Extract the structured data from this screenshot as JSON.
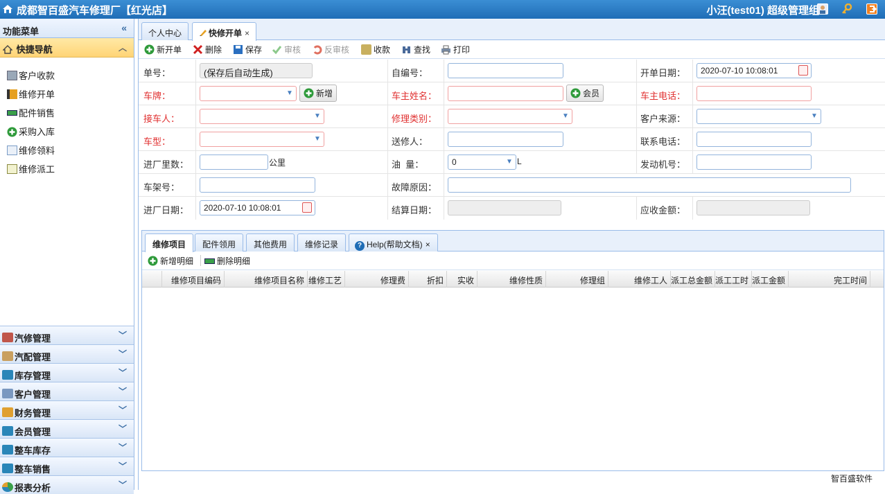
{
  "header": {
    "title": "成都智百盛汽车修理厂【红光店】",
    "user": "小汪(test01)  超级管理组"
  },
  "sidebar": {
    "menu_title": "功能菜单",
    "quick_nav": "快捷导航",
    "quick_items": [
      {
        "label": "客户收款",
        "icon": "cash-register-icon"
      },
      {
        "label": "维修开单",
        "icon": "notebook-icon"
      },
      {
        "label": "配件销售",
        "icon": "card-icon"
      },
      {
        "label": "采购入库",
        "icon": "plus-icon"
      },
      {
        "label": "维修领料",
        "icon": "form-icon"
      },
      {
        "label": "维修派工",
        "icon": "checklist-icon"
      }
    ],
    "groups": [
      {
        "label": "汽修管理",
        "icon": "tools-icon"
      },
      {
        "label": "汽配管理",
        "icon": "box-icon"
      },
      {
        "label": "库存管理",
        "icon": "warehouse-icon"
      },
      {
        "label": "客户管理",
        "icon": "contact-icon"
      },
      {
        "label": "财务管理",
        "icon": "finance-icon"
      },
      {
        "label": "会员管理",
        "icon": "member-icon"
      },
      {
        "label": "整车库存",
        "icon": "vehicle-stock-icon"
      },
      {
        "label": "整车销售",
        "icon": "vehicle-sales-icon"
      },
      {
        "label": "报表分析",
        "icon": "pie-chart-icon"
      }
    ]
  },
  "tabs": [
    {
      "label": "个人中心"
    },
    {
      "label": "快修开单",
      "close": "×"
    }
  ],
  "toolbar": {
    "new": "新开单",
    "delete": "删除",
    "save": "保存",
    "audit": "审核",
    "unaudit": "反审核",
    "collect": "收款",
    "find": "查找",
    "print": "打印"
  },
  "form": {
    "order_no_label": "单号：",
    "order_no_value": "(保存后自动生成)",
    "self_no_label": "自编号：",
    "open_date_label": "开单日期：",
    "open_date_value": "2020-07-10 10:08:01",
    "plate_label": "车牌：",
    "add_label": "新增",
    "owner_label": "车主姓名：",
    "member_label": "会员",
    "owner_phone_label": "车主电话：",
    "receiver_label": "接车人：",
    "repair_type_label": "修理类别：",
    "source_label": "客户来源：",
    "model_label": "车型：",
    "sender_label": "送修人：",
    "contact_label": "联系电话：",
    "mileage_label": "进厂里数：",
    "mileage_unit": "公里",
    "oil_label": "油  量：",
    "oil_value": "0",
    "oil_unit": "L",
    "engine_label": "发动机号：",
    "vin_label": "车架号：",
    "fault_label": "故障原因：",
    "entry_date_label": "进厂日期：",
    "entry_date_value": "2020-07-10 10:08:01",
    "settle_date_label": "结算日期：",
    "receivable_label": "应收金额："
  },
  "subtabs": [
    {
      "label": "维修项目"
    },
    {
      "label": "配件领用"
    },
    {
      "label": "其他费用"
    },
    {
      "label": "维修记录"
    },
    {
      "label": "Help(帮助文档)",
      "close": "×"
    }
  ],
  "subtoolbar": {
    "add": "新增明细",
    "remove": "删除明细"
  },
  "grid": {
    "columns": [
      "维修项目编码",
      "维修项目名称",
      "维修工艺",
      "修理费",
      "折扣",
      "实收",
      "维修性质",
      "修理组",
      "维修工人",
      "派工总金额",
      "派工工时",
      "派工金额",
      "完工时间"
    ]
  },
  "footer": "智百盛软件",
  "colors": {
    "header": "#2a7cc7",
    "required": "#e03030",
    "quick_nav": "#ffd476"
  }
}
